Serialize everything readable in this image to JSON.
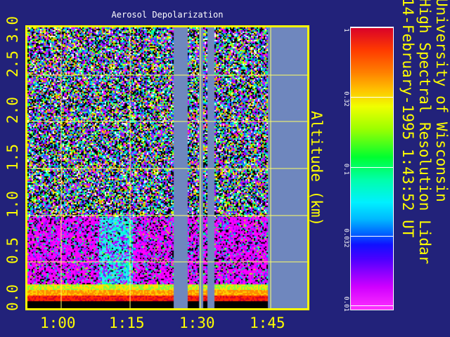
{
  "plot": {
    "title": "Aerosol Depolarization",
    "y_axis_label": "Altitude (km)",
    "y_ticks": [
      "0.0",
      "0.5",
      "1.0",
      "1.5",
      "2.0",
      "2.5",
      "3.0"
    ],
    "x_ticks": [
      "1:00",
      "1:15",
      "1:30",
      "1:45"
    ]
  },
  "colorbar": {
    "ticks": [
      "1",
      "0.32",
      "0.1",
      "0.032",
      "0.01"
    ]
  },
  "header": {
    "line1": "University of Wisconsin",
    "line2": "High Spectral Resolution Lidar",
    "line3": "14-February-1995   1:43:52 UT"
  },
  "colors": {
    "background": "#22227a",
    "axis": "#ffff00",
    "data_gap": "#6f87be"
  }
}
